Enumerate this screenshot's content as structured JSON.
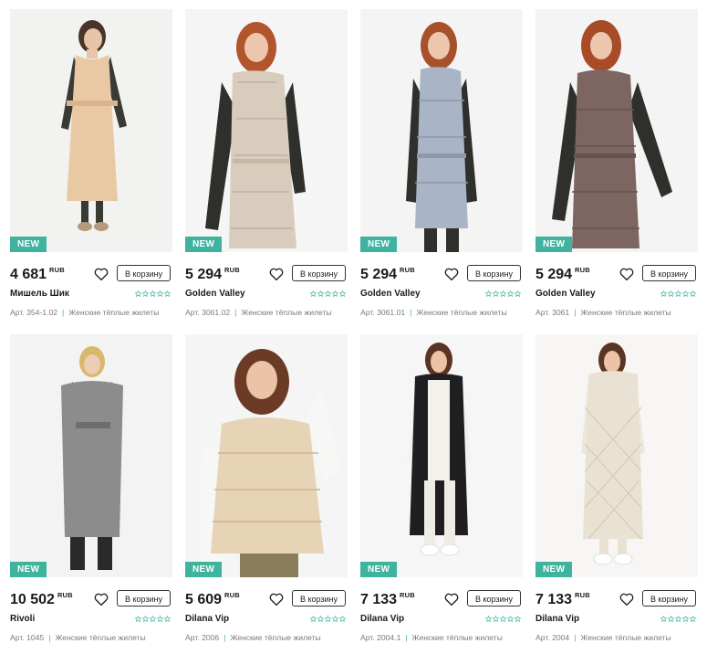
{
  "currency": "RUB",
  "cart_label": "В корзину",
  "badge_label": "NEW",
  "accent": "#3fb39e",
  "products": [
    {
      "price": "4 681",
      "brand": "Мишель Шик",
      "art": "Арт. 354-1.02",
      "category": "Женские тёплые жилеты",
      "new": true
    },
    {
      "price": "5 294",
      "brand": "Golden Valley",
      "art": "Арт. 3061.02",
      "category": "Женские тёплые жилеты",
      "new": true
    },
    {
      "price": "5 294",
      "brand": "Golden Valley",
      "art": "Арт. 3061.01",
      "category": "Женские тёплые жилеты",
      "new": true
    },
    {
      "price": "5 294",
      "brand": "Golden Valley",
      "art": "Арт. 3061",
      "category": "Женские тёплые жилеты",
      "new": true
    },
    {
      "price": "10 502",
      "brand": "Rivoli",
      "art": "Арт. 1045",
      "category": "Женские тёплые жилеты",
      "new": true
    },
    {
      "price": "5 609",
      "brand": "Dilana Vip",
      "art": "Арт. 2006",
      "category": "Женские тёплые жилеты",
      "new": true
    },
    {
      "price": "7 133",
      "brand": "Dilana Vip",
      "art": "Арт. 2004.1",
      "category": "Женские тёплые жилеты",
      "new": true
    },
    {
      "price": "7 133",
      "brand": "Dilana Vip",
      "art": "Арт. 2004",
      "category": "Женские тёплые жилеты",
      "new": true
    }
  ]
}
